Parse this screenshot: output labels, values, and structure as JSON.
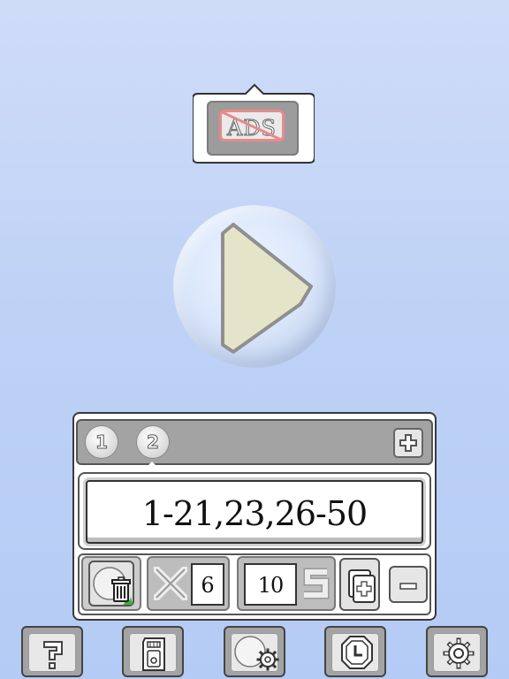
{
  "ads_popup": {
    "label": "ADS"
  },
  "tabs": [
    {
      "label": "1"
    },
    {
      "label": "2"
    }
  ],
  "selected_tab": "2",
  "range": {
    "value": "1-21,23,26-50"
  },
  "repeat": {
    "prefix_icon": "x-icon",
    "value": "6"
  },
  "interval": {
    "value": "10",
    "suffix_icon": "s-icon"
  },
  "toolbar": {
    "icons": [
      "question-icon",
      "sd-card-icon",
      "ball-settings-icon",
      "timer-icon",
      "gear-icon"
    ]
  }
}
